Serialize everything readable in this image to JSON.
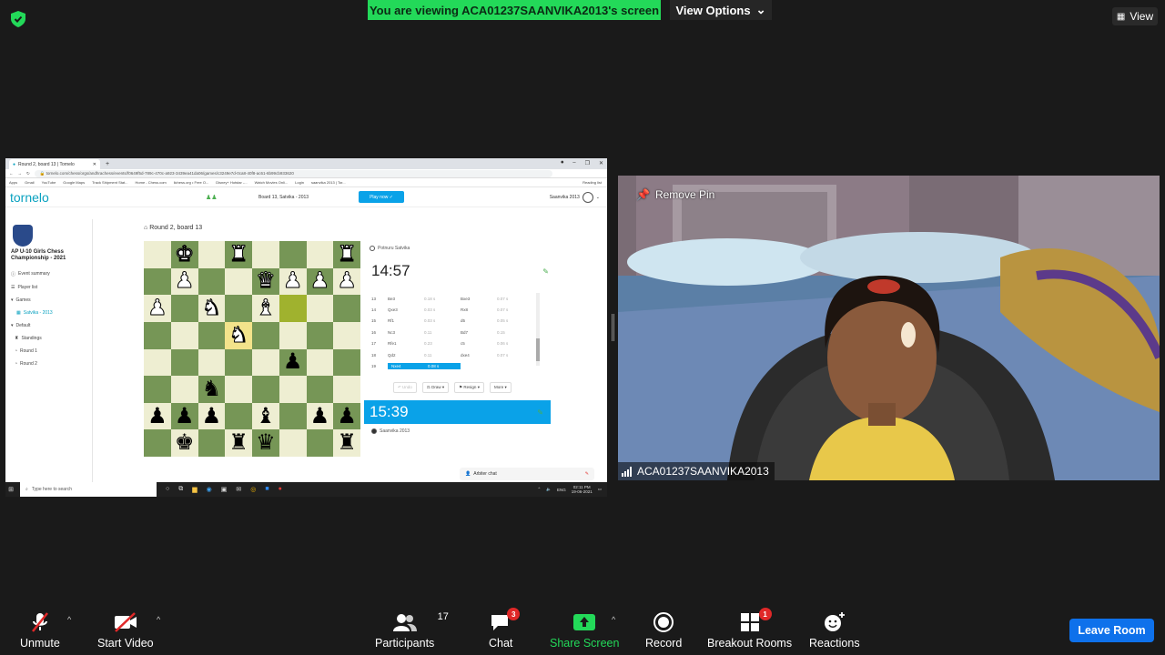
{
  "top": {
    "viewing_banner": "You are viewing ACA01237SAANVIKA2013's screen",
    "view_options": "View Options",
    "view_button": "View"
  },
  "browser": {
    "tab_title": "Round 2, board 13 | Tornelo",
    "url": "tornelo.com/chess/orgs/andhrachess/events/f0649f5d-789c-470c-a923-3439ea41da06/games/c3249e7d-0ca8-40f8-ac61-6b99cb933620",
    "bookmarks": [
      "Apps",
      "Gmail",
      "YouTube",
      "Google Maps",
      "Track Shipment Stat...",
      "Home - Chess.com",
      "lichess.org • Free O...",
      "Disney+ Hotstar -...",
      "Watch Movies Onli...",
      "Login",
      "saanvika 2013 | Tor..."
    ],
    "reading_list": "Reading list"
  },
  "tornelo": {
    "logo": "tornelo",
    "board_title": "Board 13, Satvika - 2013",
    "play_now": "Play now ✓",
    "user": "Saanvika 2013",
    "event_title": "AP U-10 Girls Chess Championship - 2021",
    "sidebar": [
      {
        "label": "Event summary",
        "icon": "info-icon"
      },
      {
        "label": "Player list",
        "icon": "list-icon"
      },
      {
        "label": "Games",
        "icon": "chevron-down-icon"
      },
      {
        "label": "Satvika - 2013",
        "icon": "board-icon",
        "active": true
      },
      {
        "label": "Default",
        "icon": "chevron-down-icon"
      },
      {
        "label": "Standings",
        "icon": "trophy-icon"
      },
      {
        "label": "Round 1",
        "icon": "round-icon"
      },
      {
        "label": "Round 2",
        "icon": "round-icon"
      }
    ],
    "round_label": "Round 2, board 13",
    "opponent": "Potnuru Satvika",
    "opponent_clock": "14:57",
    "my_clock": "15:39",
    "me": "Saanvika 2013",
    "moves": [
      {
        "n": "13",
        "w": "Be3",
        "wt": "0.18 s",
        "b": "Bxe3",
        "bt": "0.07 s"
      },
      {
        "n": "14",
        "w": "Qxe3",
        "wt": "0.03 s",
        "b": "Rx8",
        "bt": "0.07 s"
      },
      {
        "n": "15",
        "w": "Rf1",
        "wt": "0.03 s",
        "b": "d5",
        "bt": "0.05 s"
      },
      {
        "n": "16",
        "w": "Nc3",
        "wt": "0.11",
        "b": "Bd7",
        "bt": "0.15"
      },
      {
        "n": "17",
        "w": "Rfe1",
        "wt": "0.23",
        "b": "c5",
        "bt": "0.06 s"
      },
      {
        "n": "18",
        "w": "Qd2",
        "wt": "0.11",
        "b": "dxe4",
        "bt": "0.07 s"
      },
      {
        "n": "19",
        "w": "Nxe4",
        "wt": "0.08 s",
        "b": "",
        "bt": "",
        "current": true
      }
    ],
    "actions": [
      "Undo",
      "Draw",
      "Resign",
      "More"
    ],
    "arbiter_chat": "Arbiter chat",
    "board_rows": [
      [
        "",
        "wK",
        "",
        "wR",
        "",
        "",
        "",
        "wR"
      ],
      [
        "",
        "wP",
        "",
        "",
        "wQ",
        "wP",
        "wP",
        "wP"
      ],
      [
        "wP",
        "",
        "wN",
        "",
        "wB",
        "",
        "",
        ""
      ],
      [
        "",
        "",
        "",
        "wN",
        "",
        "",
        "",
        ""
      ],
      [
        "",
        "",
        "",
        "",
        "",
        "bP",
        "",
        ""
      ],
      [
        "",
        "",
        "bN",
        "",
        "",
        "",
        "",
        ""
      ],
      [
        "bP",
        "bP",
        "bP",
        "",
        "bB",
        "",
        "bP",
        "bP"
      ],
      [
        "",
        "bK",
        "",
        "bR",
        "bQ",
        "",
        "",
        "bR"
      ]
    ]
  },
  "taskbar": {
    "search_placeholder": "Type here to search",
    "lang": "ENG",
    "time": "02:11 PM",
    "date": "19-06-2021"
  },
  "video": {
    "remove_pin": "Remove Pin",
    "participant_name": "ACA01237SAANVIKA2013"
  },
  "toolbar": {
    "unmute": "Unmute",
    "start_video": "Start Video",
    "participants": "Participants",
    "participants_count": "17",
    "chat": "Chat",
    "chat_badge": "3",
    "share_screen": "Share Screen",
    "record": "Record",
    "breakout_rooms": "Breakout Rooms",
    "breakout_badge": "1",
    "reactions": "Reactions",
    "leave_room": "Leave Room"
  },
  "colors": {
    "zoom_green": "#23d959",
    "zoom_blue": "#0e71eb",
    "tornelo_blue": "#0aa2e8",
    "board_light": "#eeeed2",
    "board_dark": "#769656"
  }
}
